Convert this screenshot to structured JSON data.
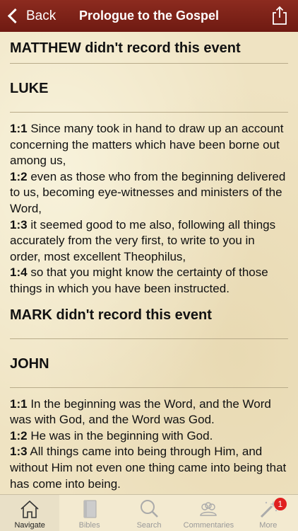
{
  "navbar": {
    "back_label": "Back",
    "title": "Prologue to the Gospel"
  },
  "sections": {
    "matthew": {
      "heading": "MATTHEW didn't record this event"
    },
    "luke": {
      "heading": "LUKE",
      "verses": [
        {
          "num": "1:1",
          "text": "Since many took in hand to draw up an account concerning the matters which have been borne out among us,"
        },
        {
          "num": "1:2",
          "text": "even as those who from the beginning delivered to us, becoming eye-witnesses and ministers of the Word,"
        },
        {
          "num": "1:3",
          "text": "it seemed good to me also, following all things accurately from the very first, to write to you in order, most excellent Theophilus,"
        },
        {
          "num": "1:4",
          "text": "so that you might know the certainty of those things in which you have been instructed."
        }
      ]
    },
    "mark": {
      "heading": "MARK didn't record this event"
    },
    "john": {
      "heading": "JOHN",
      "verses": [
        {
          "num": "1:1",
          "text": "In the beginning was the Word, and the Word was with God, and the Word was God."
        },
        {
          "num": "1:2",
          "text": "He was in the beginning with God."
        },
        {
          "num": "1:3",
          "text": "All things came into being through Him, and without Him not even one thing came into being that has come into being."
        }
      ]
    }
  },
  "tabbar": {
    "tabs": [
      {
        "label": "Navigate",
        "icon": "home-icon",
        "active": true
      },
      {
        "label": "Bibles",
        "icon": "book-icon"
      },
      {
        "label": "Search",
        "icon": "search-icon"
      },
      {
        "label": "Commentaries",
        "icon": "people-icon"
      },
      {
        "label": "More",
        "icon": "magic-wand-icon",
        "badge": "1"
      }
    ]
  },
  "colors": {
    "navbar": "#7e2217",
    "parchment": "#efe3c2",
    "badge": "#e02020"
  }
}
